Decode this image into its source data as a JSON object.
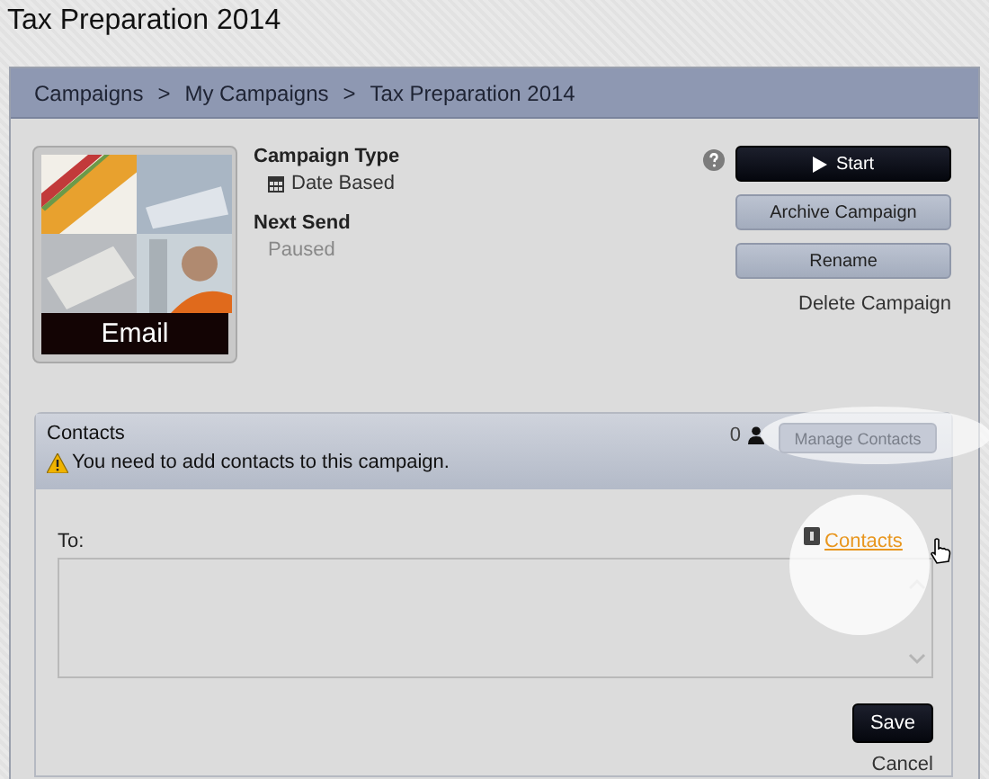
{
  "page_title": "Tax Preparation 2014",
  "breadcrumb": [
    "Campaigns",
    "My Campaigns",
    "Tax Preparation 2014"
  ],
  "breadcrumb_separator": ">",
  "thumbnail": {
    "kind": "picture",
    "label": "Email"
  },
  "campaign_type": {
    "label": "Campaign Type",
    "value": "Date Based"
  },
  "next_send": {
    "label": "Next Send",
    "value": "Paused"
  },
  "actions": [
    {
      "label": "Start",
      "kind": "primary"
    },
    {
      "label": "Archive Campaign",
      "kind": "secondary"
    },
    {
      "label": "Rename",
      "kind": "secondary"
    },
    {
      "label": "Delete Campaign",
      "kind": "link"
    }
  ],
  "contacts": {
    "title": "Contacts",
    "warning": "You need to add contacts to this campaign.",
    "count": "0",
    "manage_button": {
      "label": "Manage Contacts",
      "disabled": true,
      "highlighted": true
    }
  },
  "recipients": {
    "label": "To:",
    "link": {
      "label": "Contacts",
      "highlighted": true
    }
  },
  "form_buttons": [
    {
      "label": "Save",
      "kind": "primary"
    },
    {
      "label": "Cancel",
      "kind": "link"
    }
  ]
}
